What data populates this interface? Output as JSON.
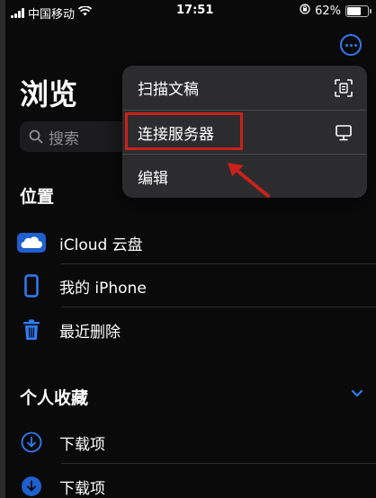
{
  "status": {
    "carrier": "中国移动",
    "time": "17:51",
    "battery": "62%",
    "battery_level": 0.62
  },
  "header": {
    "title": "浏览"
  },
  "search": {
    "placeholder": "搜索"
  },
  "locations": {
    "heading": "位置",
    "items": [
      {
        "label": "iCloud 云盘",
        "icon": "icloud-icon"
      },
      {
        "label": "我的 iPhone",
        "icon": "iphone-icon"
      },
      {
        "label": "最近删除",
        "icon": "trash-icon"
      }
    ]
  },
  "favorites": {
    "heading": "个人收藏",
    "items": [
      {
        "label": "下载项",
        "icon": "download-icon"
      },
      {
        "label": "下载项",
        "icon": "download-icon"
      }
    ]
  },
  "menu": {
    "items": [
      {
        "label": "扫描文稿",
        "icon": "scan-document-icon"
      },
      {
        "label": "连接服务器",
        "icon": "monitor-icon"
      },
      {
        "label": "编辑"
      }
    ]
  },
  "colors": {
    "accent": "#2f7cf6",
    "highlight_box": "#c8211b",
    "menu_bg": "#2c2c2e"
  }
}
